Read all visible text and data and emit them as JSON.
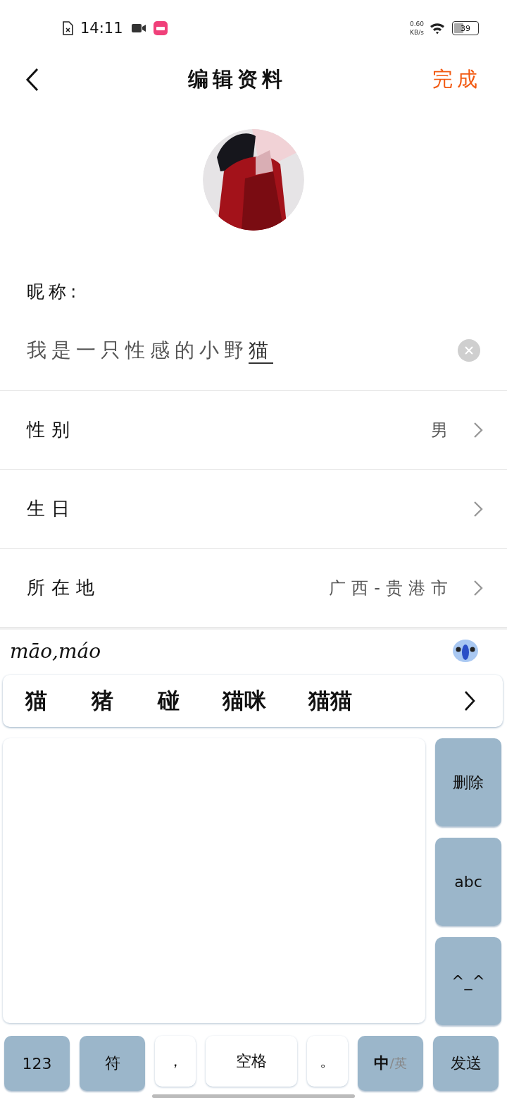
{
  "status_bar": {
    "time": "14:11",
    "net_speed": "0.60",
    "net_unit": "KB/s",
    "battery": "39"
  },
  "header": {
    "title": "编辑资料",
    "action": "完成"
  },
  "nickname": {
    "label": "昵称:",
    "value": "我是一只性感的小野",
    "composing": "猫"
  },
  "rows": [
    {
      "label": "性别",
      "value": "男"
    },
    {
      "label": "生日"
    },
    {
      "label": "所在地",
      "value": "广西-贵港市"
    }
  ],
  "keyboard": {
    "pinyin": "māo,máo",
    "candidates": [
      "猫",
      "猪",
      "碰",
      "猫咪",
      "猫猫"
    ],
    "side_keys": [
      {
        "label": "删除",
        "kind": "text"
      },
      {
        "label": "abc",
        "kind": "text"
      },
      {
        "label": "^_^",
        "kind": "text"
      }
    ],
    "bottom_keys": [
      {
        "label": "123",
        "kind": "function"
      },
      {
        "label": "符",
        "kind": "function"
      },
      {
        "label": "，",
        "kind": "plain"
      },
      {
        "label": "空格",
        "kind": "space"
      },
      {
        "label": "。",
        "kind": "plain"
      },
      {
        "label": "中",
        "alt": "/英",
        "kind": "mode"
      },
      {
        "label": "发送",
        "kind": "function"
      }
    ]
  }
}
